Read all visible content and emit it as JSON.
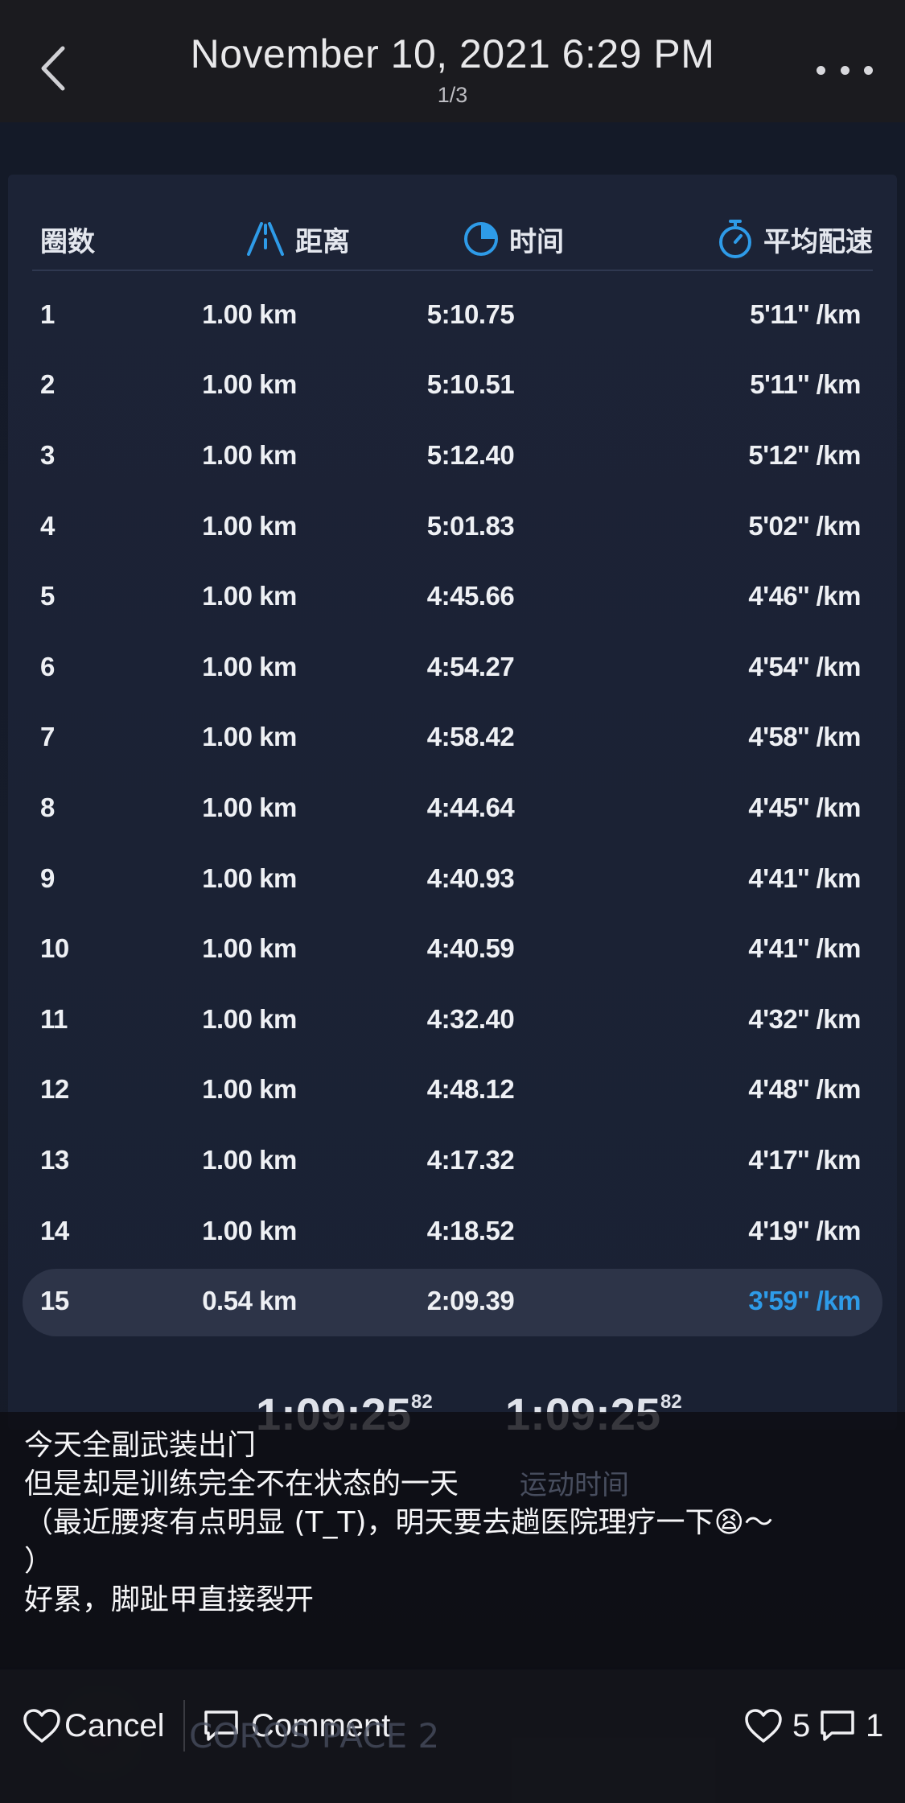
{
  "header": {
    "title": "November 10, 2021 6:29 PM",
    "subtitle": "1/3",
    "back_icon": "chevron-left-icon",
    "more_icon": "more-horizontal-icon"
  },
  "table": {
    "columns": {
      "laps": "圈数",
      "distance": "距离",
      "time": "时间",
      "pace": "平均配速"
    },
    "rows": [
      {
        "lap": "1",
        "distance": "1.00 km",
        "time": "5:10.75",
        "pace": "5'11'' /km"
      },
      {
        "lap": "2",
        "distance": "1.00 km",
        "time": "5:10.51",
        "pace": "5'11'' /km"
      },
      {
        "lap": "3",
        "distance": "1.00 km",
        "time": "5:12.40",
        "pace": "5'12'' /km"
      },
      {
        "lap": "4",
        "distance": "1.00 km",
        "time": "5:01.83",
        "pace": "5'02'' /km"
      },
      {
        "lap": "5",
        "distance": "1.00 km",
        "time": "4:45.66",
        "pace": "4'46'' /km"
      },
      {
        "lap": "6",
        "distance": "1.00 km",
        "time": "4:54.27",
        "pace": "4'54'' /km"
      },
      {
        "lap": "7",
        "distance": "1.00 km",
        "time": "4:58.42",
        "pace": "4'58'' /km"
      },
      {
        "lap": "8",
        "distance": "1.00 km",
        "time": "4:44.64",
        "pace": "4'45'' /km"
      },
      {
        "lap": "9",
        "distance": "1.00 km",
        "time": "4:40.93",
        "pace": "4'41'' /km"
      },
      {
        "lap": "10",
        "distance": "1.00 km",
        "time": "4:40.59",
        "pace": "4'41'' /km"
      },
      {
        "lap": "11",
        "distance": "1.00 km",
        "time": "4:32.40",
        "pace": "4'32'' /km"
      },
      {
        "lap": "12",
        "distance": "1.00 km",
        "time": "4:48.12",
        "pace": "4'48'' /km"
      },
      {
        "lap": "13",
        "distance": "1.00 km",
        "time": "4:17.32",
        "pace": "4'17'' /km"
      },
      {
        "lap": "14",
        "distance": "1.00 km",
        "time": "4:18.52",
        "pace": "4'19'' /km"
      },
      {
        "lap": "15",
        "distance": "0.54 km",
        "time": "2:09.39",
        "pace": "3'59'' /km",
        "highlight": true
      }
    ],
    "highlight_color": "#2e9be8"
  },
  "totals": {
    "total_time_main": "1:09:25",
    "total_time_sup": "82",
    "moving_time_main": "1:09:25",
    "moving_time_sup": "82",
    "moving_time_label": "运动时间"
  },
  "caption": {
    "text": "今天全副武装出门\n但是却是训练完全不在状态的一天\n（最近腰疼有点明显 (T_T)，明天要去趟医院理疗一下😫～\n）\n好累，脚趾甲直接裂开"
  },
  "brand": "COROS PACE 2",
  "footer": {
    "cancel_label": "Cancel",
    "comment_label": "Comment",
    "likes_count": "5",
    "comments_count": "1"
  },
  "colors": {
    "accent_blue": "#2e9be8",
    "topbar_bg": "#1b1b1f",
    "panel_bg": "#1c2336"
  }
}
